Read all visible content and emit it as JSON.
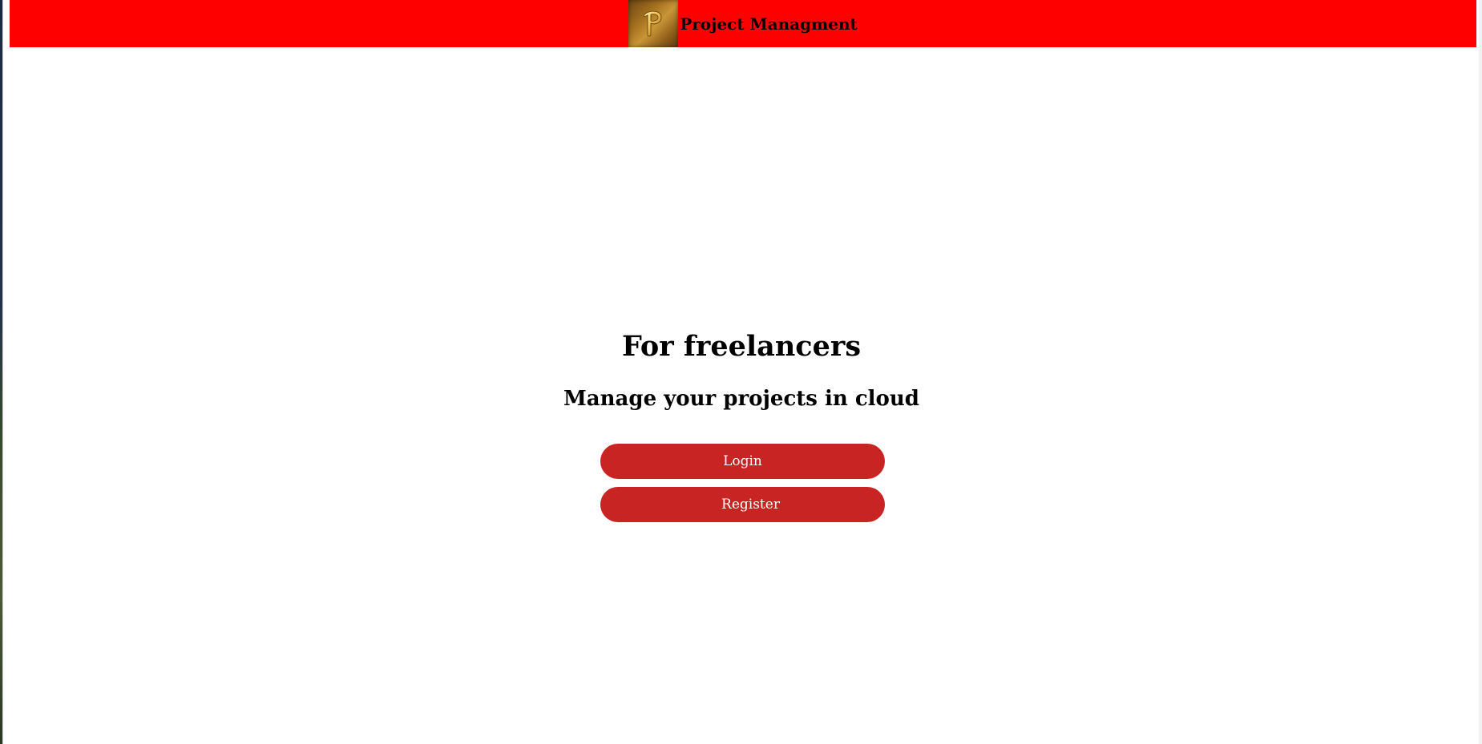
{
  "header": {
    "title": "Project Managment",
    "logo_icon": "gold-letter-p-icon",
    "background_color": "#ff0000"
  },
  "hero": {
    "title": "For freelancers",
    "subtitle": "Manage your projects in cloud"
  },
  "actions": {
    "login_label": "Login",
    "register_label": "Register",
    "button_color": "#c92424"
  }
}
